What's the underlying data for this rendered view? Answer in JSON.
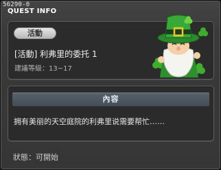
{
  "window": {
    "version": "56290-0",
    "title": "QUEST INFO"
  },
  "quest": {
    "badge": "活動",
    "name": "[活動] 利弗里的委托 1",
    "level_requirement": "建議等級：13~17"
  },
  "content": {
    "header": "內容",
    "description": "拥有美丽的天空庭院的利弗里说需要帮忙……"
  },
  "status": {
    "text": "狀態：可開始"
  },
  "npc": {
    "icon": "leprechaun-npc-icon"
  },
  "colors": {
    "hat_green": "#2f9a2f",
    "panel_bg": "#2b2b2b",
    "header_bg": "#4b5660"
  }
}
